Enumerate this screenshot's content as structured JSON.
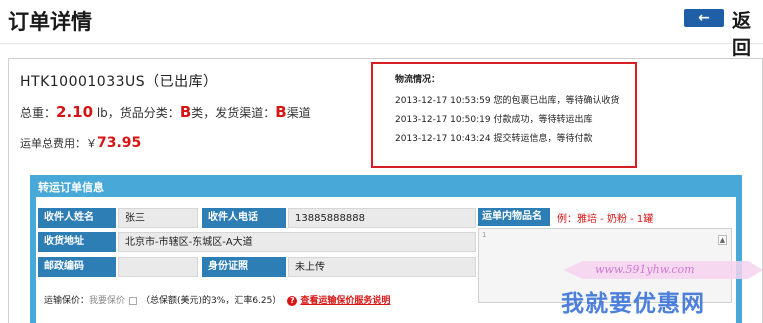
{
  "header": {
    "title": "订单详情",
    "back_arrow": "←",
    "back_label": "返回"
  },
  "order": {
    "number": "HTK10001033US（已出库）",
    "weight_prefix": "总重：",
    "weight_value": "2.10",
    "weight_unit": " lb，货品分类：",
    "category": "B",
    "category_suffix": "类，发货渠道：",
    "channel": "B",
    "channel_suffix": "渠道",
    "fee_label": "运单总费用：￥",
    "fee_amount": "73.95"
  },
  "logistics": {
    "title": "物流情况：",
    "entries": [
      "2013-12-17 10:53:59 您的包裹已出库，等待确认收货",
      "2013-12-17 10:50:19 付款成功，等待转运出库",
      "2013-12-17 10:43:24 提交转运信息，等待付款"
    ]
  },
  "panel": {
    "title": "转运订单信息",
    "recipient_name_label": "收件人姓名",
    "recipient_name": "张三",
    "recipient_phone_label": "收件人电话",
    "recipient_phone": "13885888888",
    "address_label": "收货地址",
    "address": "北京市-市辖区-东城区-A大道",
    "postcode_label": "邮政编码",
    "postcode": "",
    "id_label": "身份证照",
    "id_status": "未上传",
    "goods_label": "运单内物品名",
    "goods_example": "例：雅培 - 奶粉 - 1罐",
    "goods_counter": "1",
    "insure_label": "运输保价：",
    "insure_option": "我要保价",
    "insure_note": "（总保额(美元)的3%，汇率6.25）",
    "insure_help_icon": "?",
    "insure_help_link": "查看运输保价服务说明"
  },
  "watermark": {
    "url": "www.591yhw.com",
    "text": "我就要优惠网"
  }
}
